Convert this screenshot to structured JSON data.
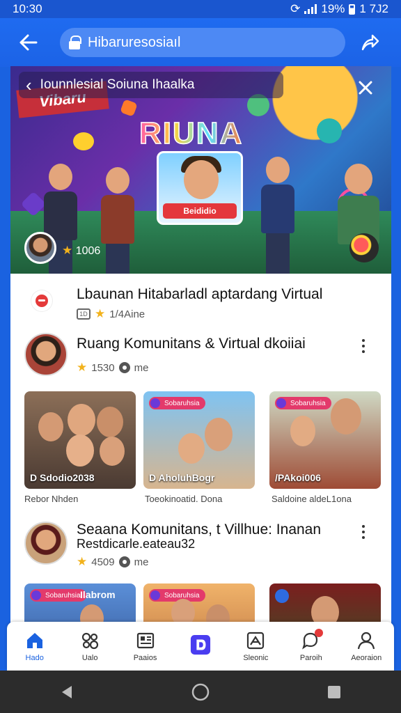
{
  "status": {
    "time": "10:30",
    "battery": "19%",
    "clock_right": "1 7J2"
  },
  "search": {
    "text": "Hibaruresosiaıl"
  },
  "hero": {
    "title": "Iounnlesial Soiuna Ihaalka",
    "banner": "Vibaru",
    "logo": "RIUNA",
    "card_button": "Beididio",
    "stat": "1006"
  },
  "section_one": {
    "title": "Lbaunan Hitabarladl aptardang Virtual",
    "meta_box": "1D",
    "meta_text": "1/4Aine"
  },
  "group_one": {
    "title": "Ruang Komunitans & Virtual dkoiiai",
    "rating": "1530",
    "meta": "me",
    "thumbs": [
      {
        "label": "D Sdodio2038",
        "caption": "Rebor Nhden",
        "tag": ""
      },
      {
        "label": "D AholuhBogr",
        "caption": "Toeokinoatid. Dona",
        "tag": "Sobaruhsia"
      },
      {
        "label": "/PAkoi006",
        "caption": "Saldoine aldeL1ona",
        "tag": "Sobaruhsia"
      }
    ]
  },
  "group_two": {
    "title": "Seaana Komunitans, t Villhue: Inanan",
    "subtitle": "Restdicarle.eateau32",
    "rating": "4509",
    "meta": "me",
    "thumbs": [
      {
        "tag": "Sobaruhsia",
        "overlay": "Ilabrom"
      },
      {
        "tag": "Sobaruhsia",
        "overlay": ""
      },
      {
        "tag": "",
        "overlay": ""
      }
    ]
  },
  "nav": {
    "items": [
      {
        "label": "Hado",
        "icon": "home-icon",
        "active": true
      },
      {
        "label": "Ualo",
        "icon": "people-icon",
        "active": false
      },
      {
        "label": "Paaios",
        "icon": "news-icon",
        "active": false
      },
      {
        "label": "",
        "icon": "app-icon",
        "active": false
      },
      {
        "label": "Sleonic",
        "icon": "image-icon",
        "active": false
      },
      {
        "label": "Paroih",
        "icon": "chat-icon",
        "active": false
      },
      {
        "label": "Aeoraion",
        "icon": "profile-icon",
        "active": false
      }
    ]
  },
  "colors": {
    "primary": "#1a62e0",
    "accent_red": "#e4373c",
    "star": "#f2b21c"
  }
}
